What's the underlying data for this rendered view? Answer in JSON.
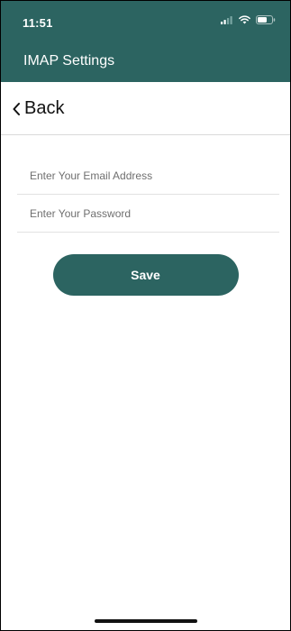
{
  "status_bar": {
    "time": "11:51",
    "icons": [
      "cellular-signal-icon",
      "wifi-icon",
      "battery-icon"
    ]
  },
  "header": {
    "title": "IMAP Settings"
  },
  "nav": {
    "back_label": "Back"
  },
  "form": {
    "email_placeholder": "Enter Your Email Address",
    "email_value": "",
    "password_placeholder": "Enter Your Password",
    "password_value": "",
    "save_label": "Save"
  },
  "colors": {
    "brand": "#2c6461",
    "divider": "#e2e2e2",
    "placeholder": "#6f6f6f"
  }
}
